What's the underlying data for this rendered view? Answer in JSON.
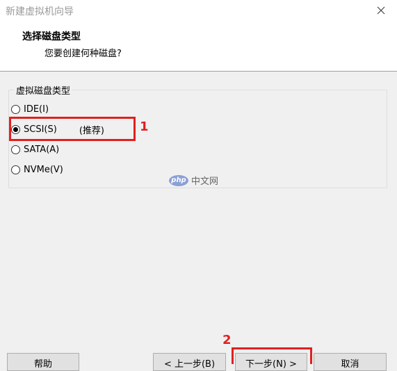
{
  "window": {
    "title": "新建虚拟机向导",
    "close_icon": "×"
  },
  "header": {
    "title": "选择磁盘类型",
    "subtitle": "您要创建何种磁盘?"
  },
  "group": {
    "legend": "虚拟磁盘类型",
    "options": [
      {
        "label": "IDE(I)",
        "checked": false
      },
      {
        "label": "SCSI(S)",
        "checked": true,
        "note": "(推荐)"
      },
      {
        "label": "SATA(A)",
        "checked": false
      },
      {
        "label": "NVMe(V)",
        "checked": false
      }
    ]
  },
  "annotations": {
    "badge1": "1",
    "badge2": "2"
  },
  "watermark": {
    "logo": "php",
    "text": "中文网"
  },
  "buttons": {
    "help": "帮助",
    "back": "< 上一步(B)",
    "next": "下一步(N) >",
    "cancel": "取消"
  },
  "colors": {
    "highlight": "#e02020",
    "background": "#f0f0f0",
    "header_bg": "#ffffff"
  }
}
